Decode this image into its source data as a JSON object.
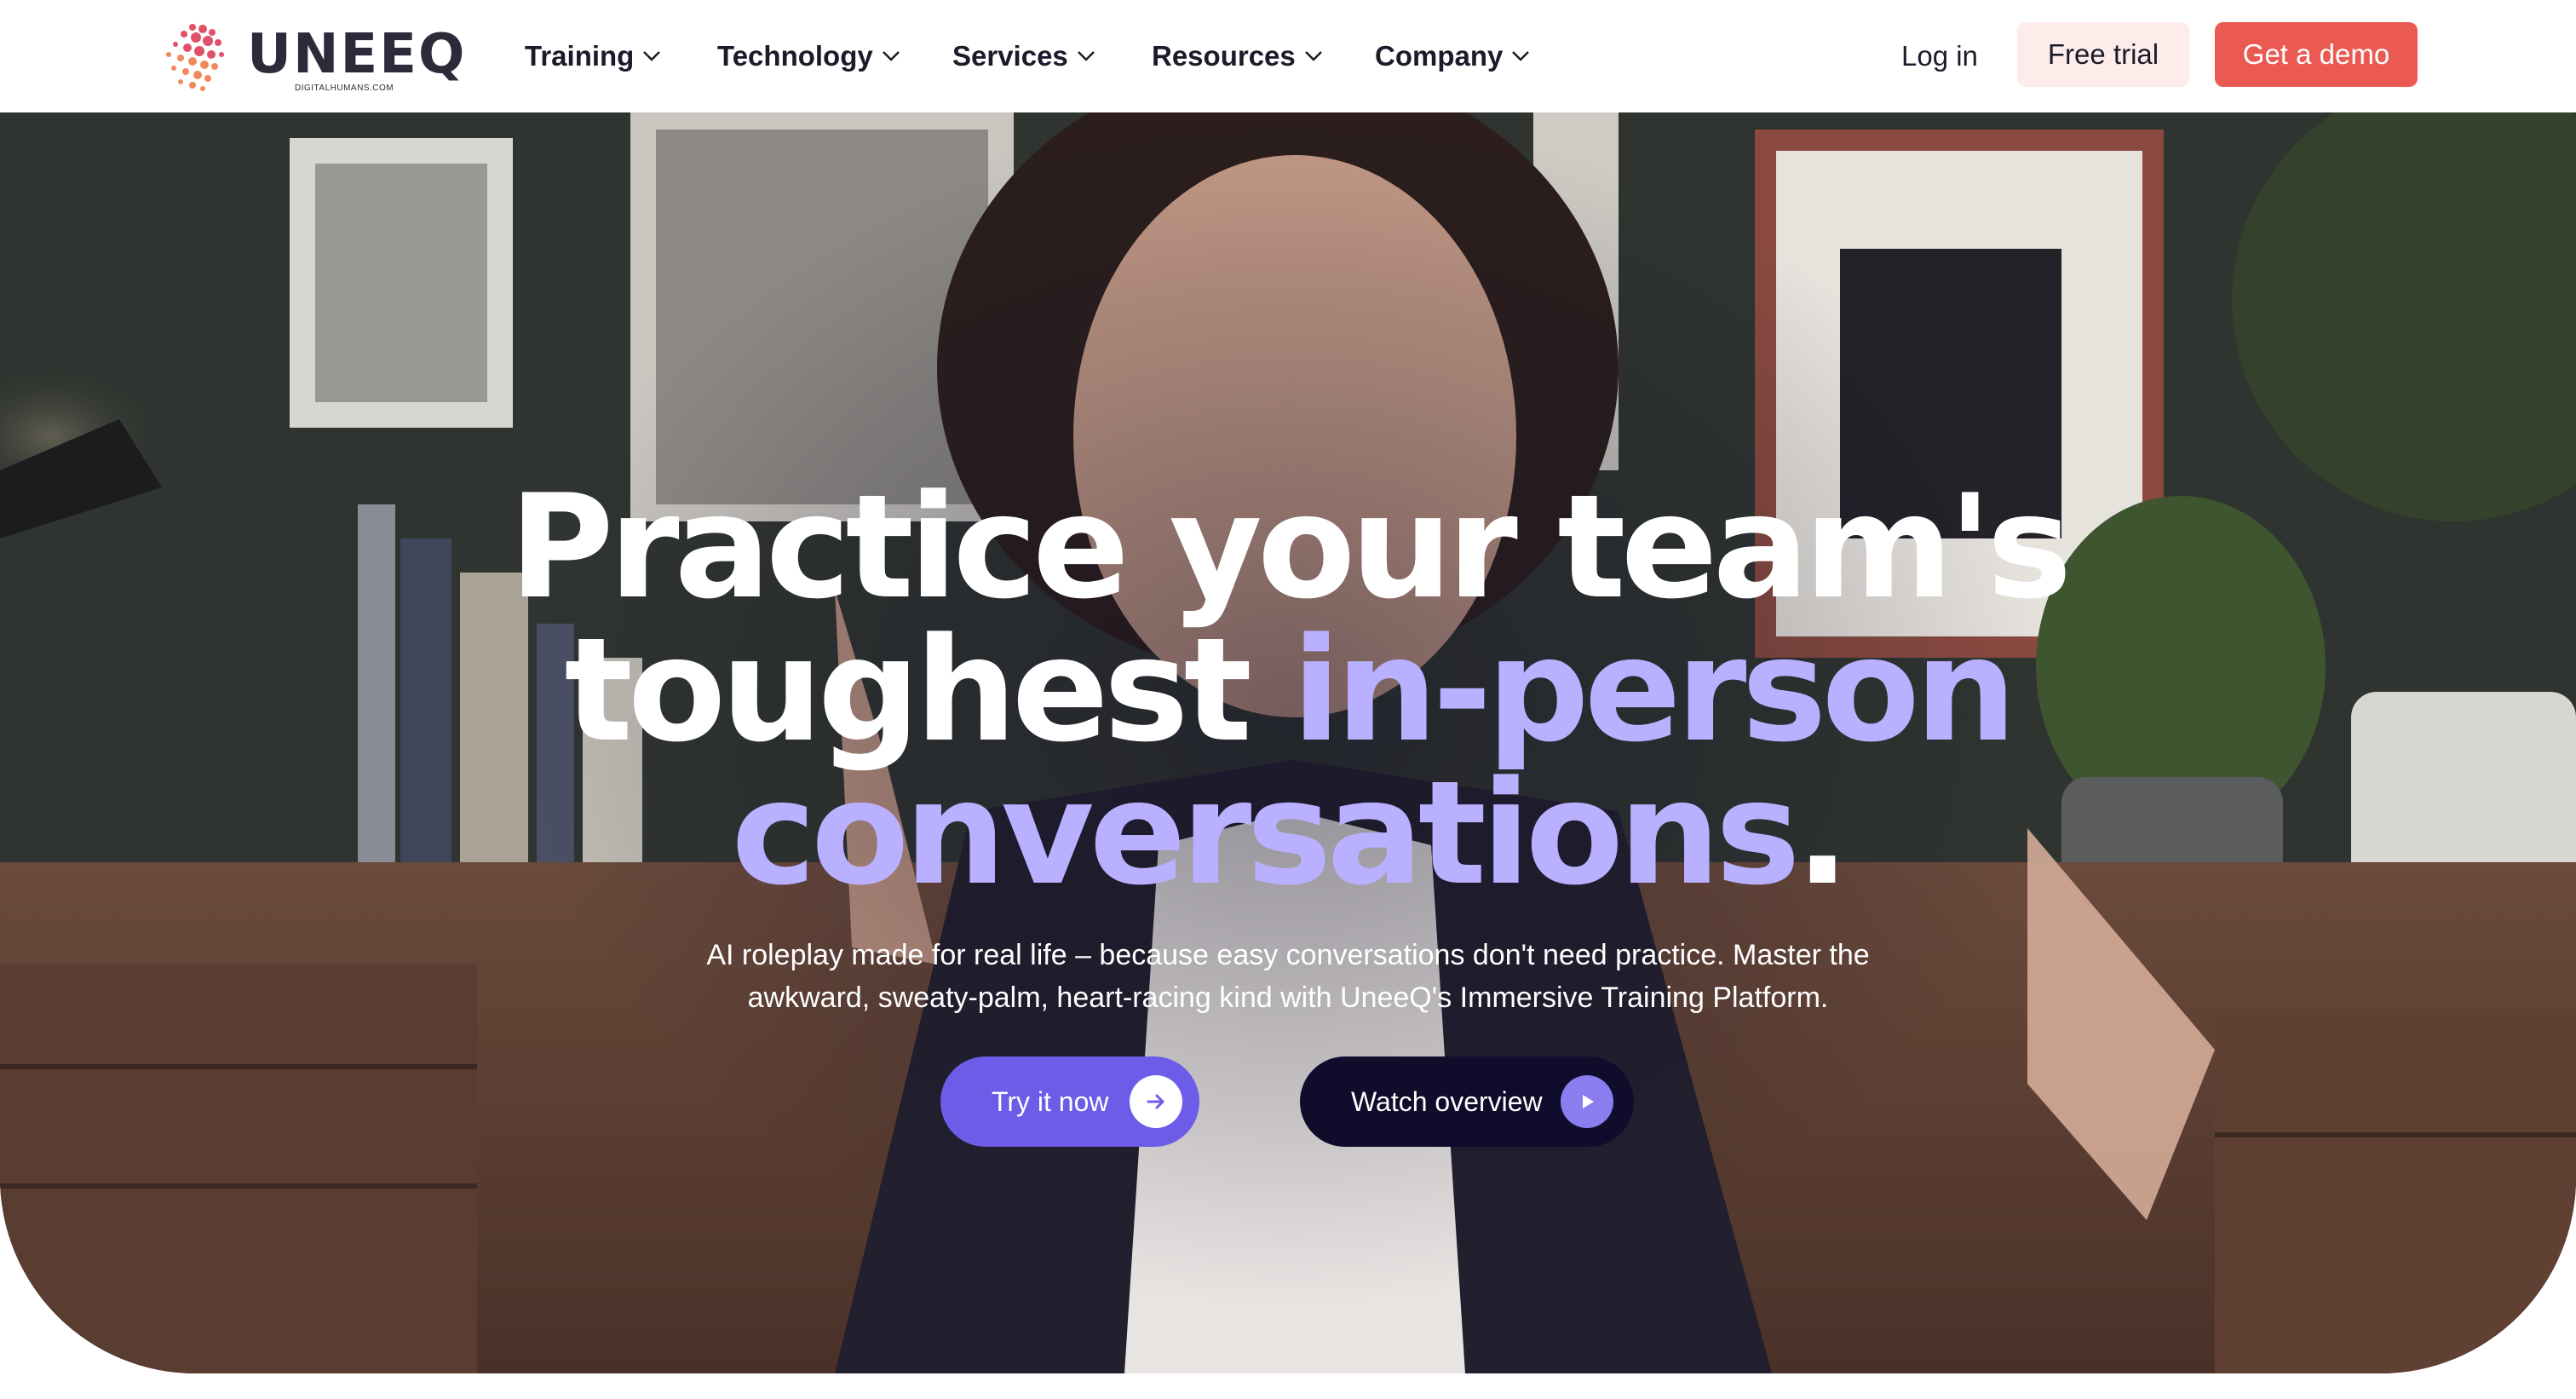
{
  "brand": {
    "logo_text": "UNEEQ",
    "logo_subtext": "DIGITALHUMANS.COM",
    "accent_color": "#ea5a52",
    "purple_color": "#6c5ce7"
  },
  "nav": {
    "items": [
      {
        "label": "Training"
      },
      {
        "label": "Technology"
      },
      {
        "label": "Services"
      },
      {
        "label": "Resources"
      },
      {
        "label": "Company"
      }
    ],
    "login_label": "Log in",
    "trial_label": "Free trial",
    "demo_label": "Get a demo"
  },
  "hero": {
    "headline_line1": "Practice your team's",
    "headline_line2_plain": "toughest",
    "headline_line2_accent": "in-person",
    "headline_line3_accent": "conversations",
    "headline_line3_plain": ".",
    "subtext": "AI roleplay made for real life – because easy conversations don't need practice. Master the awkward, sweaty-palm, heart-racing kind with UneeQ's Immersive Training Platform.",
    "try_label": "Try it now",
    "try_icon": "arrow-right-icon",
    "watch_label": "Watch overview",
    "watch_icon": "play-icon"
  }
}
